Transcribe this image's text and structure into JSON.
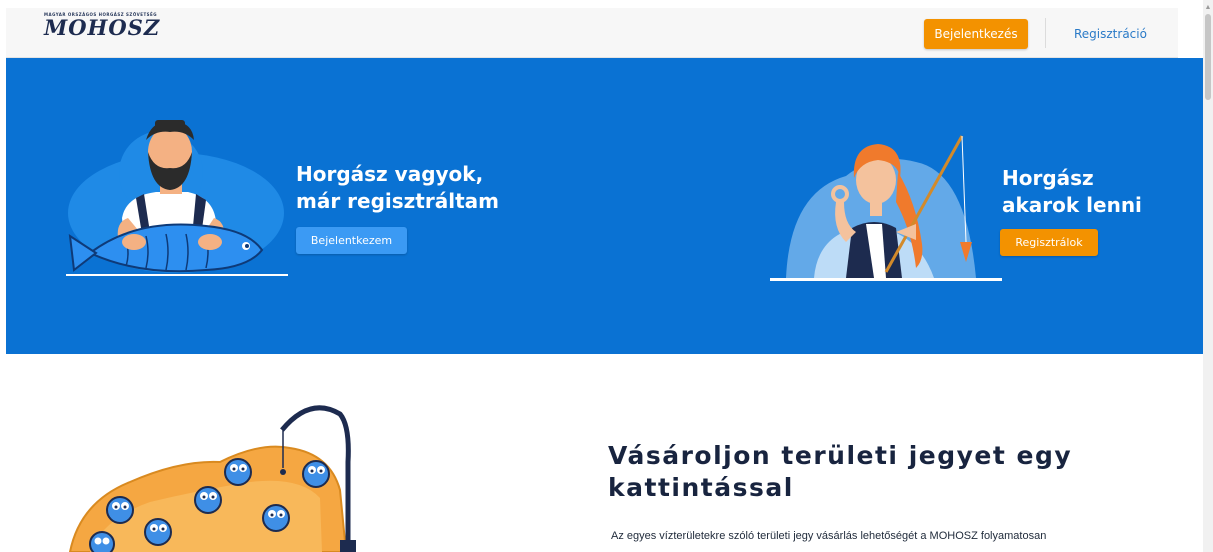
{
  "header": {
    "logo_small": "MAGYAR ORSZÁGOS HORGÁSZ SZÖVETSÉG",
    "logo_main": "MOHOSZ",
    "login_label": "Bejelentkezés",
    "register_label": "Regisztráció"
  },
  "hero": {
    "left": {
      "title_line1": "Horgász vagyok,",
      "title_line2": "már regisztráltam",
      "button_label": "Bejelentkezem"
    },
    "right": {
      "title_line1": "Horgász",
      "title_line2": "akarok lenni",
      "button_label": "Regisztrálok"
    }
  },
  "promo": {
    "title_line1": "Vásároljon területi jegyet egy",
    "title_line2": "kattintással",
    "text": "Az egyes vízterületekre szóló területi jegy vásárlás lehetőségét a MOHOSZ folyamatosan"
  },
  "colors": {
    "hero_blue": "#0a72d3",
    "accent_orange": "#f39200",
    "link_blue": "#2a7ac7",
    "button_blue": "#3b9af4"
  },
  "icons": [
    "scroll-up-arrow-icon"
  ]
}
